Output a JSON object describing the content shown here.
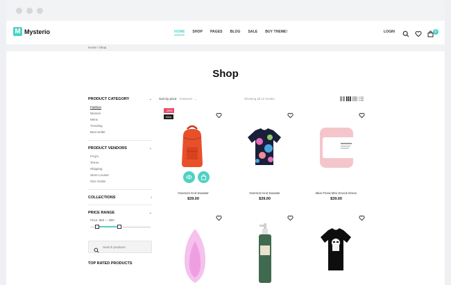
{
  "header": {
    "logo_letter": "M",
    "logo_text": "Mysterio",
    "nav": [
      "HOME",
      "SHOP",
      "PAGES",
      "BLOG",
      "SALE",
      "BUY THEME!"
    ],
    "login": "LOGIN",
    "cart_count": "0",
    "accent": "#4fd1c5"
  },
  "breadcrumb": "Home / Shop",
  "page_title": "Shop",
  "sidebar": {
    "category": {
      "title": "PRODUCT CATEGORY",
      "items": [
        "Fashion",
        "Women",
        "Mens",
        "Trending",
        "Best Seller"
      ]
    },
    "vendors": {
      "title": "PRODUCT VENDORS",
      "items": [
        "FAQ's",
        "Terms",
        "Shipping",
        "Store Locator",
        "Size Guide"
      ]
    },
    "collections": {
      "title": "COLLECTIONS"
    },
    "price": {
      "title": "PRICE RANGE",
      "text": "Price: $60 — $90"
    },
    "search_placeholder": "Search products",
    "top_rated": "TOP RATED PRODUCTS"
  },
  "toolbar": {
    "sort_label": "Sort by price:",
    "sort_value": "Featured",
    "showing": "Showing all 12 results"
  },
  "products": [
    {
      "name": "Oversize Knit Sweater",
      "price": "$39.00",
      "sale_badge": "-25%",
      "new_badge": "New"
    },
    {
      "name": "Oversize Knit Sweater",
      "price": "$39.00"
    },
    {
      "name": "Blue Floral Mini Smock Dress",
      "price": "$39.00"
    },
    {
      "name": "",
      "price": ""
    },
    {
      "name": "",
      "price": ""
    },
    {
      "name": "",
      "price": ""
    }
  ]
}
